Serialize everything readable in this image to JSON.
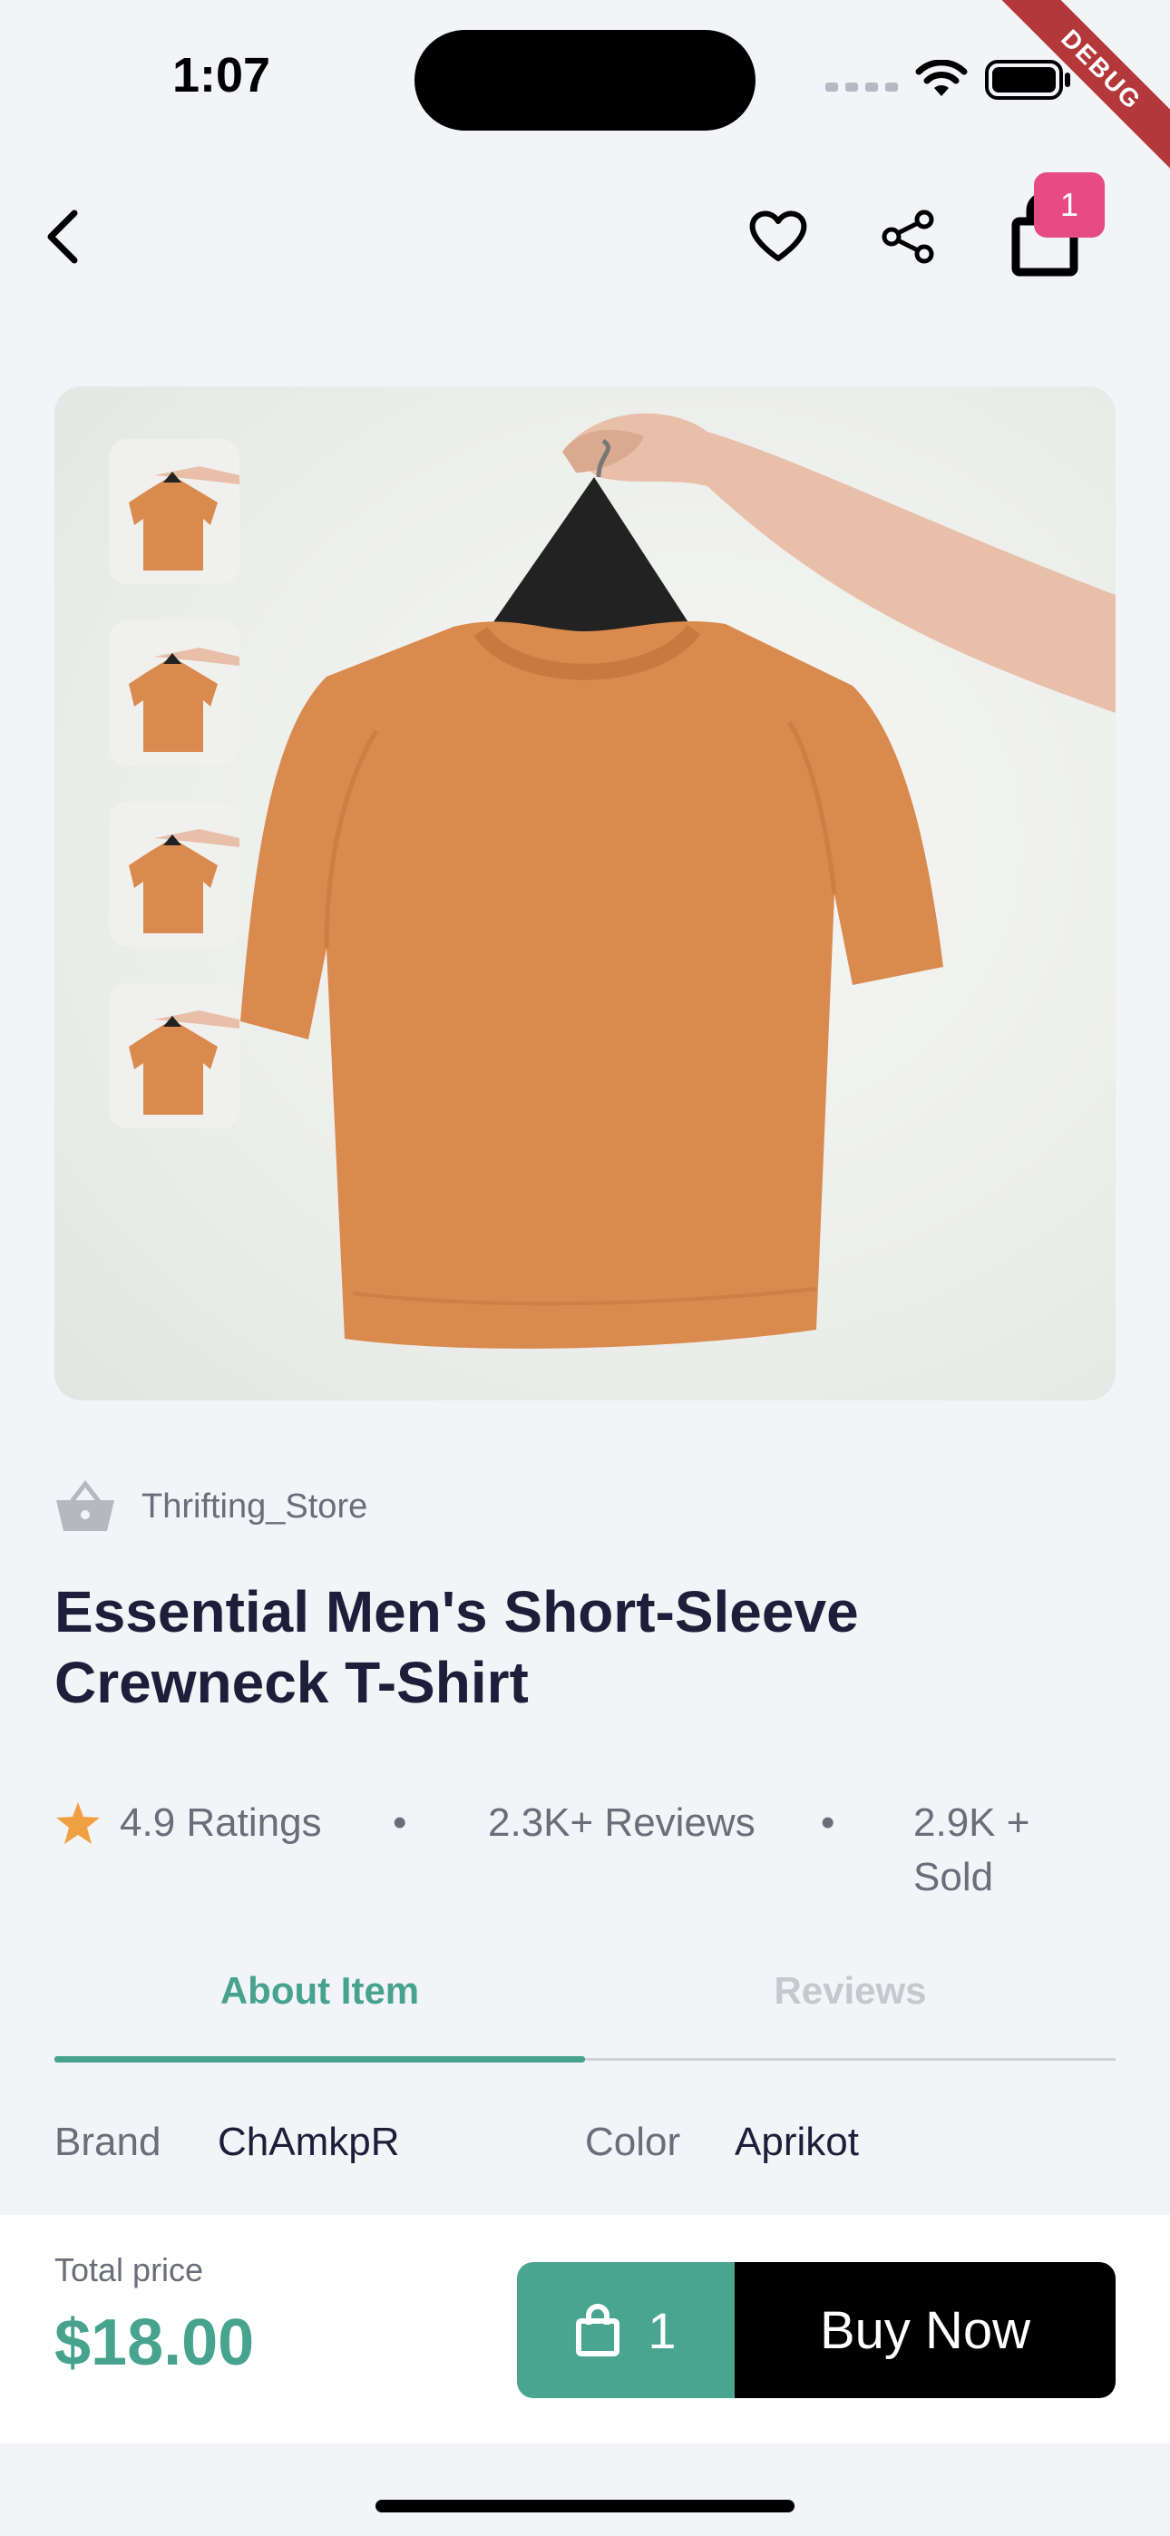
{
  "status_bar": {
    "time": "1:07",
    "debug_label": "DEBUG"
  },
  "nav": {
    "cart_count": "1"
  },
  "product": {
    "store_name": "Thrifting_Store",
    "title": "Essential Men's Short-Sleeve Crewneck T-Shirt",
    "rating": "4.9 Ratings",
    "reviews": "2.3K+ Reviews",
    "sold": "2.9K + Sold",
    "separator": "•",
    "color_accent": "#47a38e"
  },
  "tabs": [
    {
      "label": "About Item",
      "active": true
    },
    {
      "label": "Reviews",
      "active": false
    }
  ],
  "specs": {
    "brand_label": "Brand",
    "brand_value": "ChAmkpR",
    "color_label": "Color",
    "color_value": "Aprikot"
  },
  "checkout": {
    "total_label": "Total price",
    "total_price": "$18.00",
    "quantity": "1",
    "buy_label": "Buy Now"
  }
}
